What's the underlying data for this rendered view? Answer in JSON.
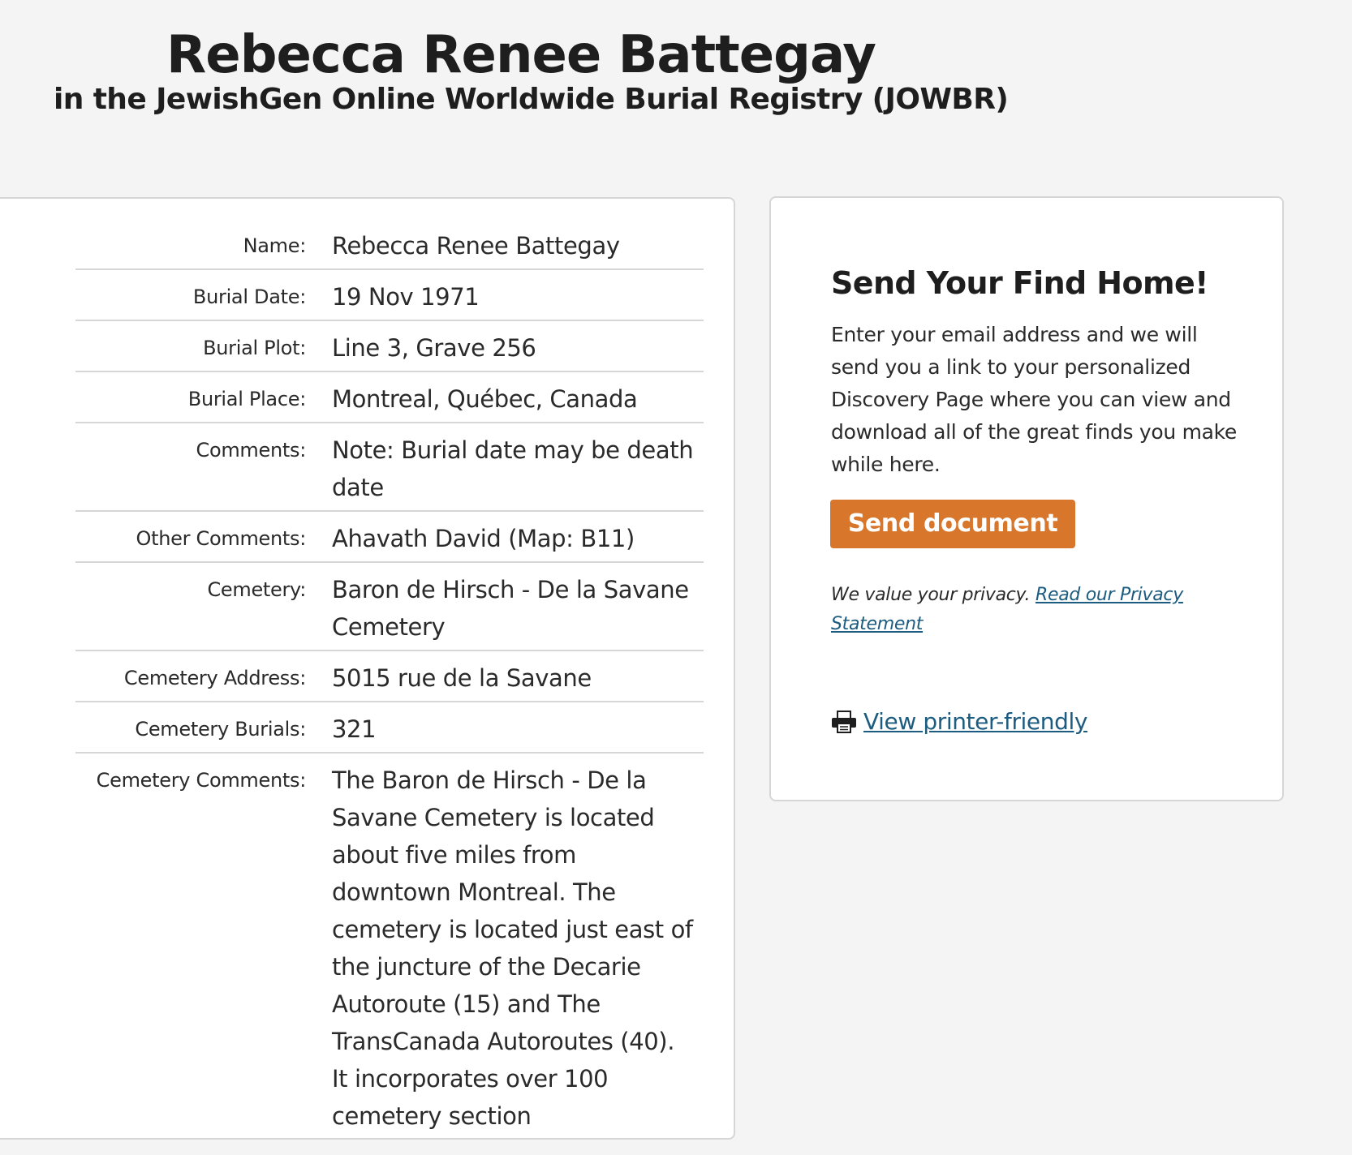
{
  "header": {
    "title": "Rebecca Renee Battegay",
    "subtitle": "in the JewishGen Online Worldwide Burial Registry (JOWBR)"
  },
  "record": {
    "fields": [
      {
        "label": "Name:",
        "value": "Rebecca Renee Battegay"
      },
      {
        "label": "Burial Date:",
        "value": "19 Nov 1971"
      },
      {
        "label": "Burial Plot:",
        "value": "Line 3, Grave 256"
      },
      {
        "label": "Burial Place:",
        "value": "Montreal, Québec, Canada"
      },
      {
        "label": "Comments:",
        "value": "Note: Burial date may be death date"
      },
      {
        "label": "Other Comments:",
        "value": "Ahavath David (Map: B11)"
      },
      {
        "label": "Cemetery:",
        "value": "Baron de Hirsch - De la Savane Cemetery"
      },
      {
        "label": "Cemetery Address:",
        "value": "5015 rue de la Savane"
      },
      {
        "label": "Cemetery Burials:",
        "value": "321"
      },
      {
        "label": "Cemetery Comments:",
        "value": "The Baron de Hirsch - De la Savane Cemetery is located about five miles from downtown Montreal. The cemetery is located just east of the juncture of the Decarie Autoroute (15) and The TransCanada Autoroutes (40). It incorporates over 100 cemetery section"
      }
    ]
  },
  "sidebar": {
    "heading": "Send Your Find Home!",
    "description": "Enter your email address and we will send you a link to your personalized Discovery Page where you can view and download all of the great finds you make while here.",
    "send_button_label": "Send document",
    "privacy_text": "We value your privacy.",
    "privacy_link_label": "Read our Privacy Statement",
    "printer_icon": "printer-icon",
    "printer_link_label": "View printer-friendly",
    "accent_color": "#d8762c",
    "link_color": "#1c5c80"
  }
}
